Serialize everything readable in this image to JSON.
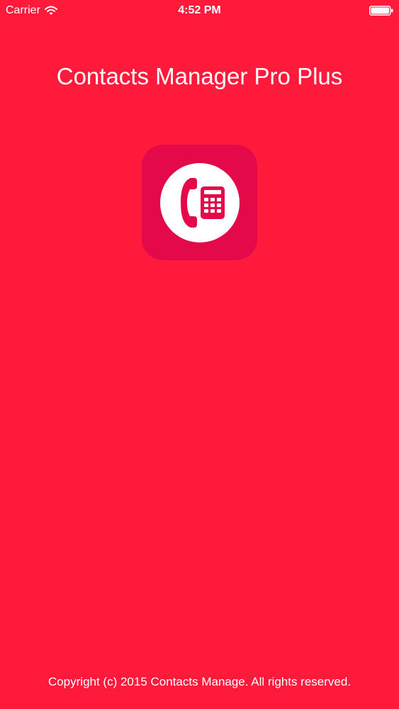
{
  "colors": {
    "background": "#ff1a3c",
    "icon_background": "#e40a4a",
    "icon_glyph": "#ffffff",
    "text": "#ffffff"
  },
  "status_bar": {
    "carrier": "Carrier",
    "time": "4:52 PM",
    "icons": [
      "wifi-icon",
      "battery-icon"
    ]
  },
  "title": "Contacts Manager Pro Plus",
  "app_icon": {
    "icon": "telephone-icon"
  },
  "footer": {
    "copyright": "Copyright (c) 2015 Contacts Manage. All rights reserved."
  }
}
